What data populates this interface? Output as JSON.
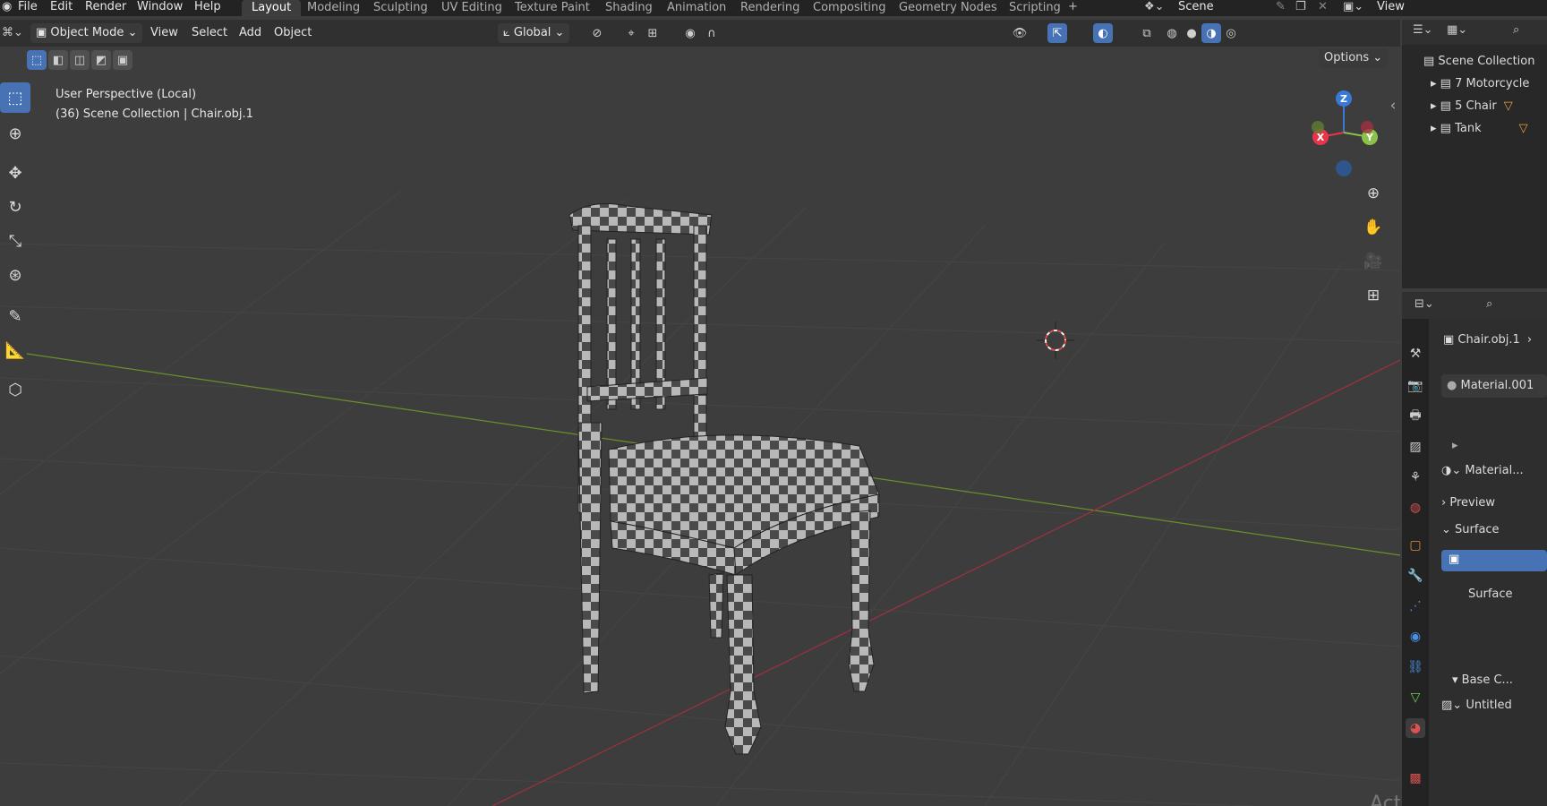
{
  "menu": {
    "file": "File",
    "edit": "Edit",
    "render": "Render",
    "window": "Window",
    "help": "Help"
  },
  "workspaces": [
    "Layout",
    "Modeling",
    "Sculpting",
    "UV Editing",
    "Texture Paint",
    "Shading",
    "Animation",
    "Rendering",
    "Compositing",
    "Geometry Nodes",
    "Scripting"
  ],
  "add_workspace": "+",
  "scene_name": "Scene",
  "view_layer": "View",
  "header": {
    "mode": "Object Mode",
    "view": "View",
    "select": "Select",
    "add": "Add",
    "object": "Object",
    "orientation": "Global",
    "options": "Options"
  },
  "viewport": {
    "perspective": "User Perspective (Local)",
    "collection_info": "(36) Scene Collection | Chair.obj.1"
  },
  "gizmo": {
    "z": "Z",
    "x": "X",
    "y": "Y"
  },
  "outliner": {
    "root": "Scene Collection",
    "items": [
      {
        "label": "7 Motorcycle"
      },
      {
        "label": "5 Chair"
      },
      {
        "label": "Tank"
      }
    ]
  },
  "properties": {
    "object_name": "Chair.obj.1",
    "material_slot": "Material.001",
    "material_selector": "Material...",
    "preview": "Preview",
    "surface_section": "Surface",
    "surface_label": "Surface",
    "base_color": "Base C...",
    "image_name": "Untitled"
  },
  "watermark": "Activate Windows",
  "colors": {
    "accent": "#4772b3",
    "x_axis": "#e8354b",
    "y_axis": "#8bc34a",
    "z_axis": "#3a7ad6"
  },
  "icons": {
    "select_tool": "select-box-icon",
    "cursor_tool": "cursor-icon",
    "move_tool": "move-icon",
    "rotate_tool": "rotate-icon",
    "scale_tool": "scale-icon",
    "transform_tool": "transform-icon",
    "annotate_tool": "annotate-icon",
    "measure_tool": "measure-icon",
    "add_cube_tool": "add-cube-icon"
  }
}
